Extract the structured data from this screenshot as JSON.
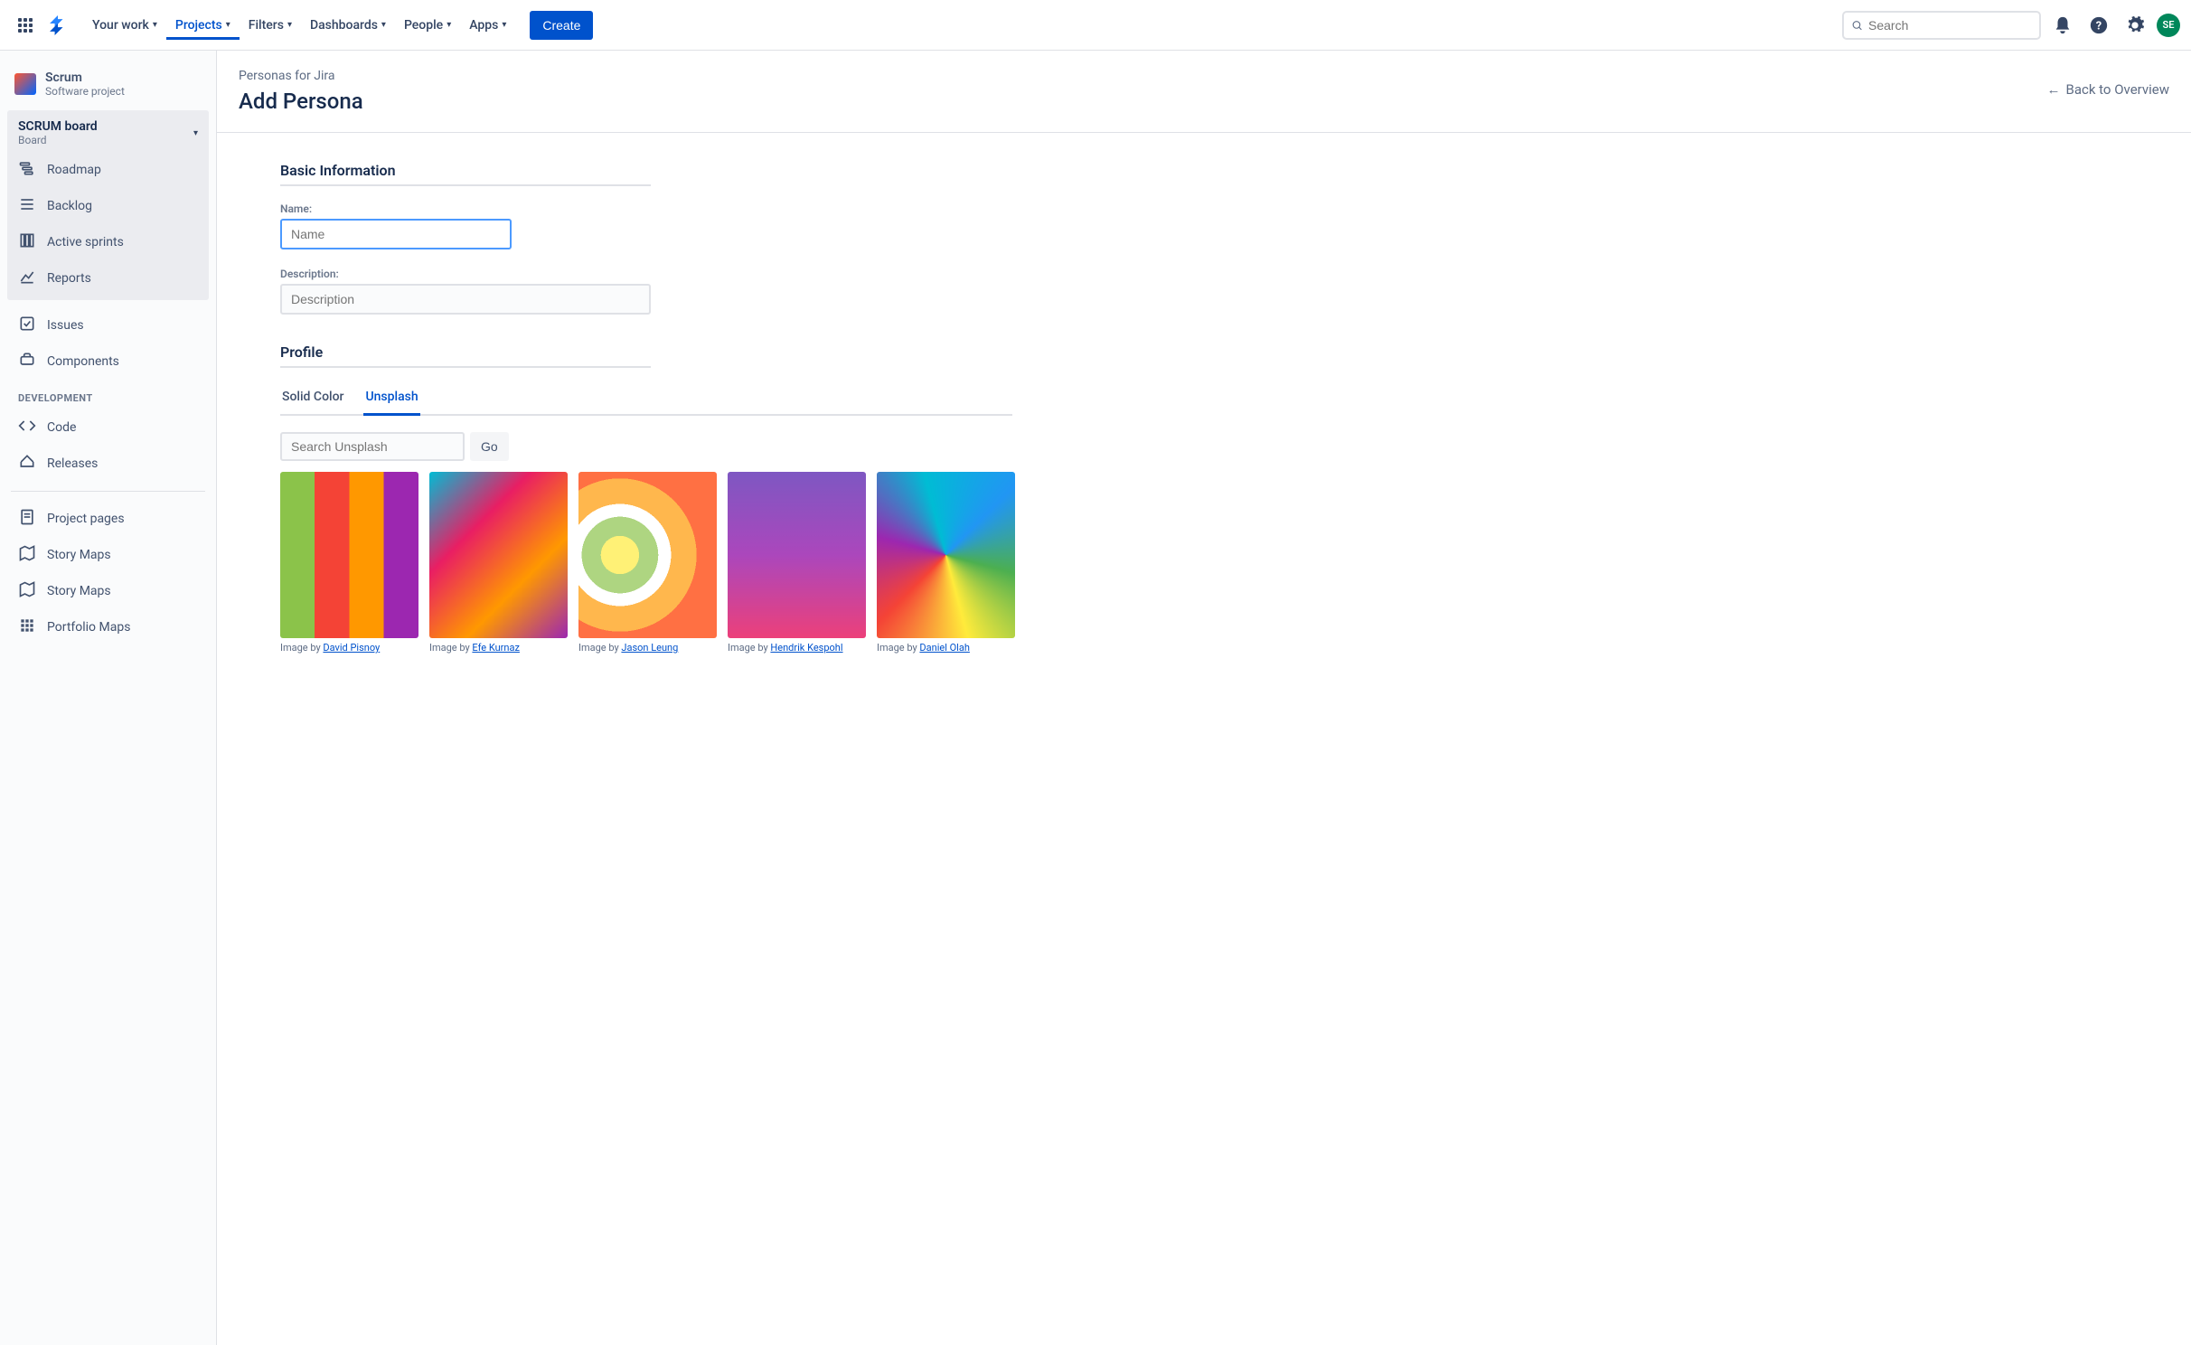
{
  "topnav": {
    "items": [
      "Your work",
      "Projects",
      "Filters",
      "Dashboards",
      "People",
      "Apps"
    ],
    "active_index": 1,
    "create": "Create",
    "search_placeholder": "Search",
    "avatar": "SE"
  },
  "sidebar": {
    "project_name": "Scrum",
    "project_sub": "Software project",
    "board_title": "SCRUM board",
    "board_sub": "Board",
    "group1": [
      "Roadmap",
      "Backlog",
      "Active sprints",
      "Reports"
    ],
    "items2": [
      "Issues",
      "Components"
    ],
    "dev_label": "DEVELOPMENT",
    "dev_items": [
      "Code",
      "Releases"
    ],
    "bottom": [
      "Project pages",
      "Story Maps",
      "Story Maps",
      "Portfolio Maps"
    ]
  },
  "page": {
    "breadcrumb": "Personas for Jira",
    "title": "Add Persona",
    "back": "Back to Overview"
  },
  "form": {
    "basic_title": "Basic Information",
    "name_label": "Name:",
    "name_placeholder": "Name",
    "desc_label": "Description:",
    "desc_placeholder": "Description",
    "profile_title": "Profile",
    "tabs": [
      "Solid Color",
      "Unsplash"
    ],
    "active_tab": 1,
    "unsplash_placeholder": "Search Unsplash",
    "go": "Go",
    "credit_prefix": "Image by ",
    "images": [
      {
        "author": "David Pisnoy"
      },
      {
        "author": "Efe Kurnaz"
      },
      {
        "author": "Jason Leung"
      },
      {
        "author": "Hendrik Kespohl"
      },
      {
        "author": "Daniel Olah"
      }
    ]
  }
}
